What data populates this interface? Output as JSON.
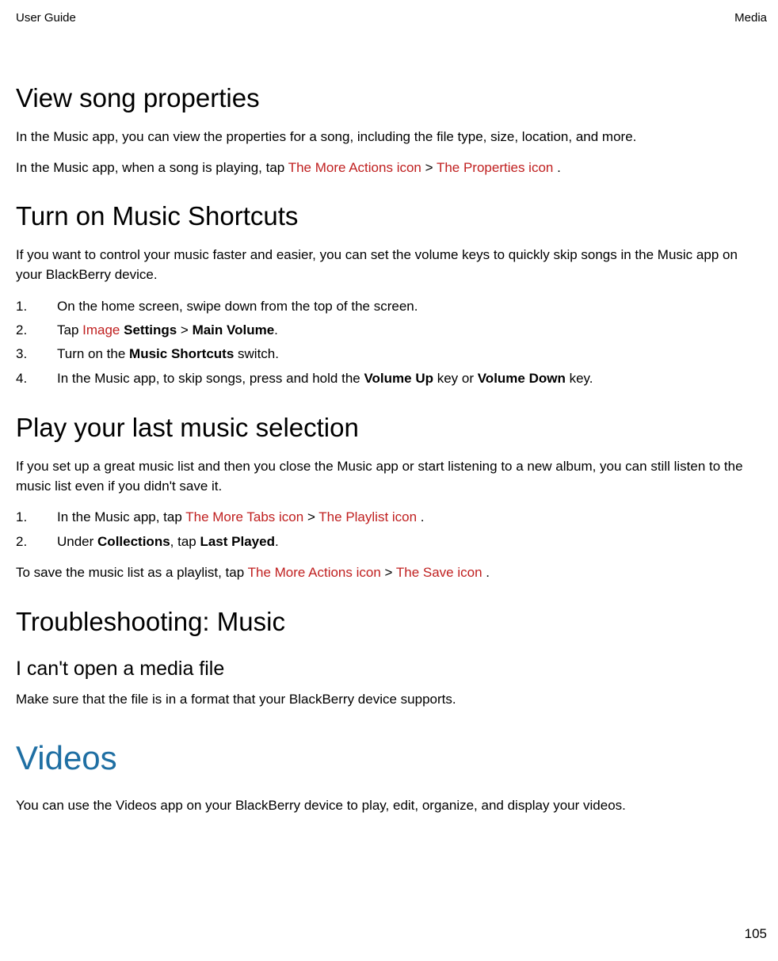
{
  "header": {
    "left": "User Guide",
    "right": "Media"
  },
  "sections": {
    "viewSong": {
      "title": "View song properties",
      "p1": "In the Music app, you can view the properties for a song, including the file type, size, location, and more.",
      "p2_pre": "In the Music app, when a song is playing, tap ",
      "p2_icon1": " The More Actions icon ",
      "p2_sep": " > ",
      "p2_icon2": " The Properties icon ",
      "p2_post": "."
    },
    "shortcuts": {
      "title": "Turn on Music Shortcuts",
      "p1": "If you want to control your music faster and easier, you can set the volume keys to quickly skip songs in the Music app on your BlackBerry device.",
      "steps": {
        "s1": "On the home screen, swipe down from the top of the screen.",
        "s2_pre": "Tap ",
        "s2_img": " Image ",
        "s2_settings": " Settings",
        "s2_gt": " > ",
        "s2_main": "Main Volume",
        "s2_post": ".",
        "s3_pre": "Turn on the ",
        "s3_bold": "Music Shortcuts",
        "s3_post": " switch.",
        "s4_pre": "In the Music app, to skip songs, press and hold the ",
        "s4_vu": "Volume Up",
        "s4_mid": " key or ",
        "s4_vd": "Volume Down",
        "s4_post": " key."
      }
    },
    "lastPlayed": {
      "title": "Play your last music selection",
      "p1": "If you set up a great music list and then you close the Music app or start listening to a new album, you can still listen to the music list even if you didn't save it.",
      "steps": {
        "s1_pre": "In the Music app, tap ",
        "s1_icon1": " The More Tabs icon ",
        "s1_sep": " > ",
        "s1_icon2": " The Playlist icon ",
        "s1_post": ".",
        "s2_pre": "Under ",
        "s2_bold1": "Collections",
        "s2_mid": ", tap ",
        "s2_bold2": "Last Played",
        "s2_post": "."
      },
      "p2_pre": "To save the music list as a playlist, tap ",
      "p2_icon1": " The More Actions icon ",
      "p2_sep": " > ",
      "p2_icon2": " The Save icon ",
      "p2_post": "."
    },
    "troubleshoot": {
      "title": "Troubleshooting: Music",
      "sub": "I can't open a media file",
      "p1": "Make sure that the file is in a format that your BlackBerry device supports."
    },
    "videos": {
      "title": "Videos",
      "p1": "You can use the Videos app on your BlackBerry device to play, edit, organize, and display your videos."
    }
  },
  "pageNumber": "105"
}
